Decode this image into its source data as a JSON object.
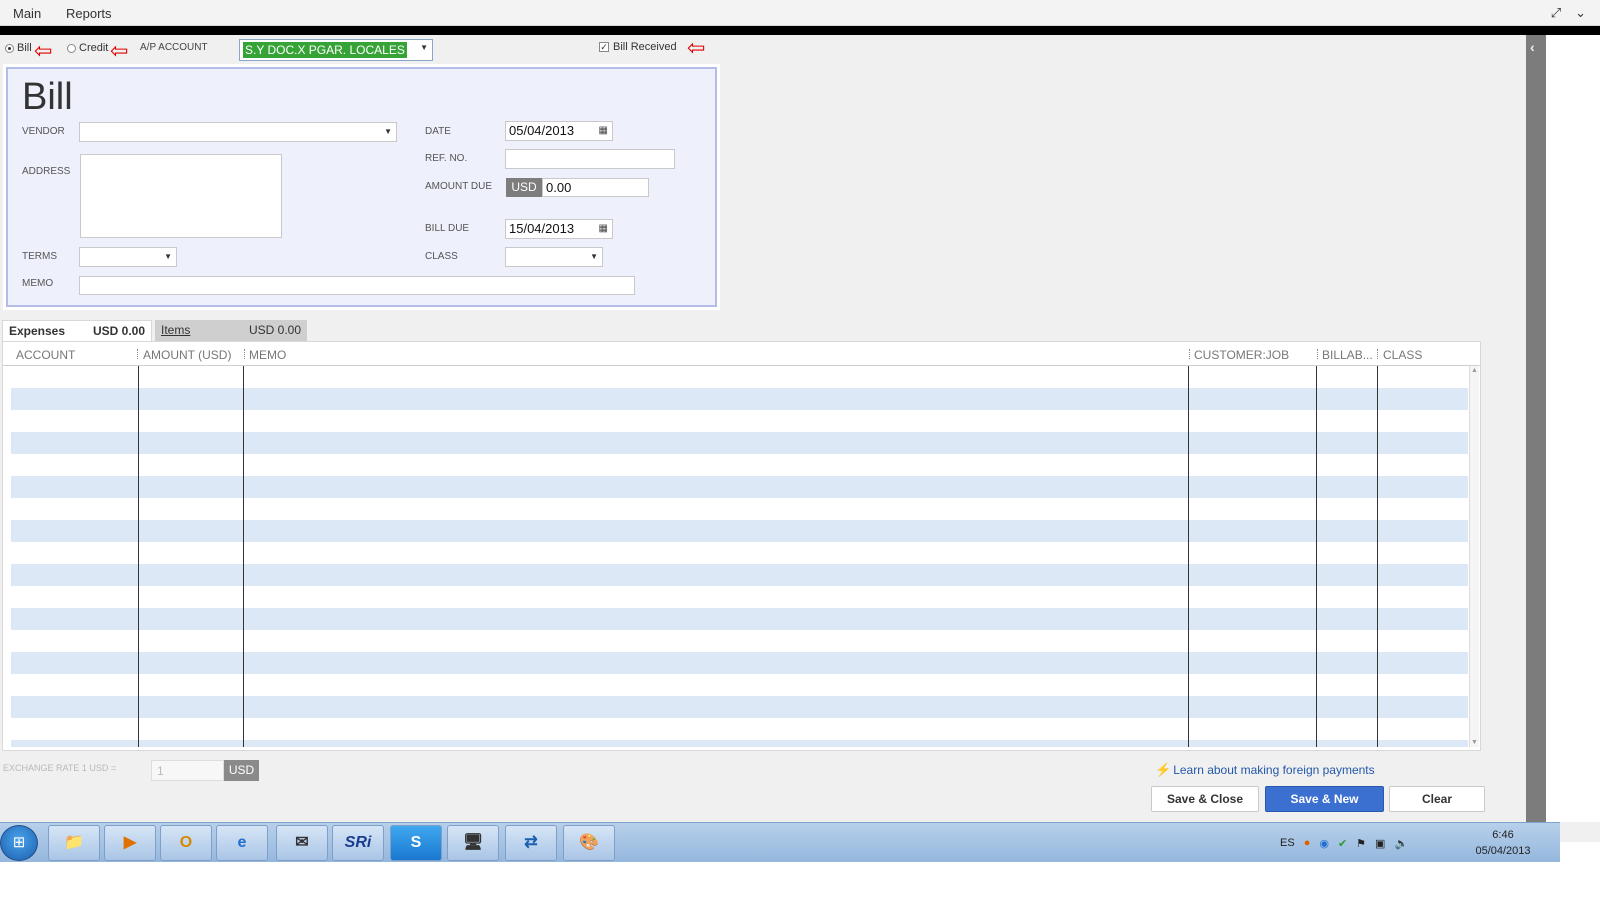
{
  "menu": {
    "main": "Main",
    "reports": "Reports",
    "expand_icon": "⤢",
    "collapse_icon": "⌄"
  },
  "toolbar": {
    "bill_radio": "Bill",
    "credit_radio": "Credit",
    "ap_account_label": "A/P ACCOUNT",
    "ap_account_value": "S.Y DOC.X PGAR. LOCALES",
    "bill_received_label": "Bill Received",
    "bill_received_checked": true,
    "annotation_arrow": "⇦"
  },
  "form": {
    "title": "Bill",
    "vendor_label": "VENDOR",
    "vendor_value": "",
    "address_label": "ADDRESS",
    "terms_label": "TERMS",
    "memo_label": "MEMO",
    "date_label": "DATE",
    "date_value": "05/04/2013",
    "ref_label": "REF. NO.",
    "amount_due_label": "AMOUNT DUE",
    "amount_currency": "USD",
    "amount_due_value": "0.00",
    "bill_due_label": "BILL DUE",
    "bill_due_value": "15/04/2013",
    "class_label": "CLASS"
  },
  "tabs": [
    {
      "label": "Expenses",
      "amount": "USD  0.00",
      "active": true
    },
    {
      "label": "Items",
      "amount": "USD  0.00",
      "active": false
    }
  ],
  "grid": {
    "columns": [
      "ACCOUNT",
      "AMOUNT (USD)",
      "MEMO",
      "CUSTOMER:JOB",
      "BILLAB...",
      "CLASS"
    ]
  },
  "bottom": {
    "exchange_label": "EXCHANGE RATE 1 USD =",
    "exchange_value": "1",
    "exchange_currency": "USD",
    "learn_link": "Learn about making foreign payments",
    "save_close": "Save & Close",
    "save_new": "Save & New",
    "clear": "Clear"
  },
  "taskbar": {
    "apps": [
      "📁",
      "▶",
      "O",
      "e",
      "✉",
      "SRi",
      "S",
      "🖥",
      "⇄",
      "🎨"
    ],
    "language": "ES",
    "time": "6:46",
    "date": "05/04/2013"
  },
  "colors": {
    "accent_blue": "#3b6fd0",
    "ap_highlight": "#36a336",
    "annotation_red": "#e00000",
    "row_stripe": "#dde8f7"
  }
}
